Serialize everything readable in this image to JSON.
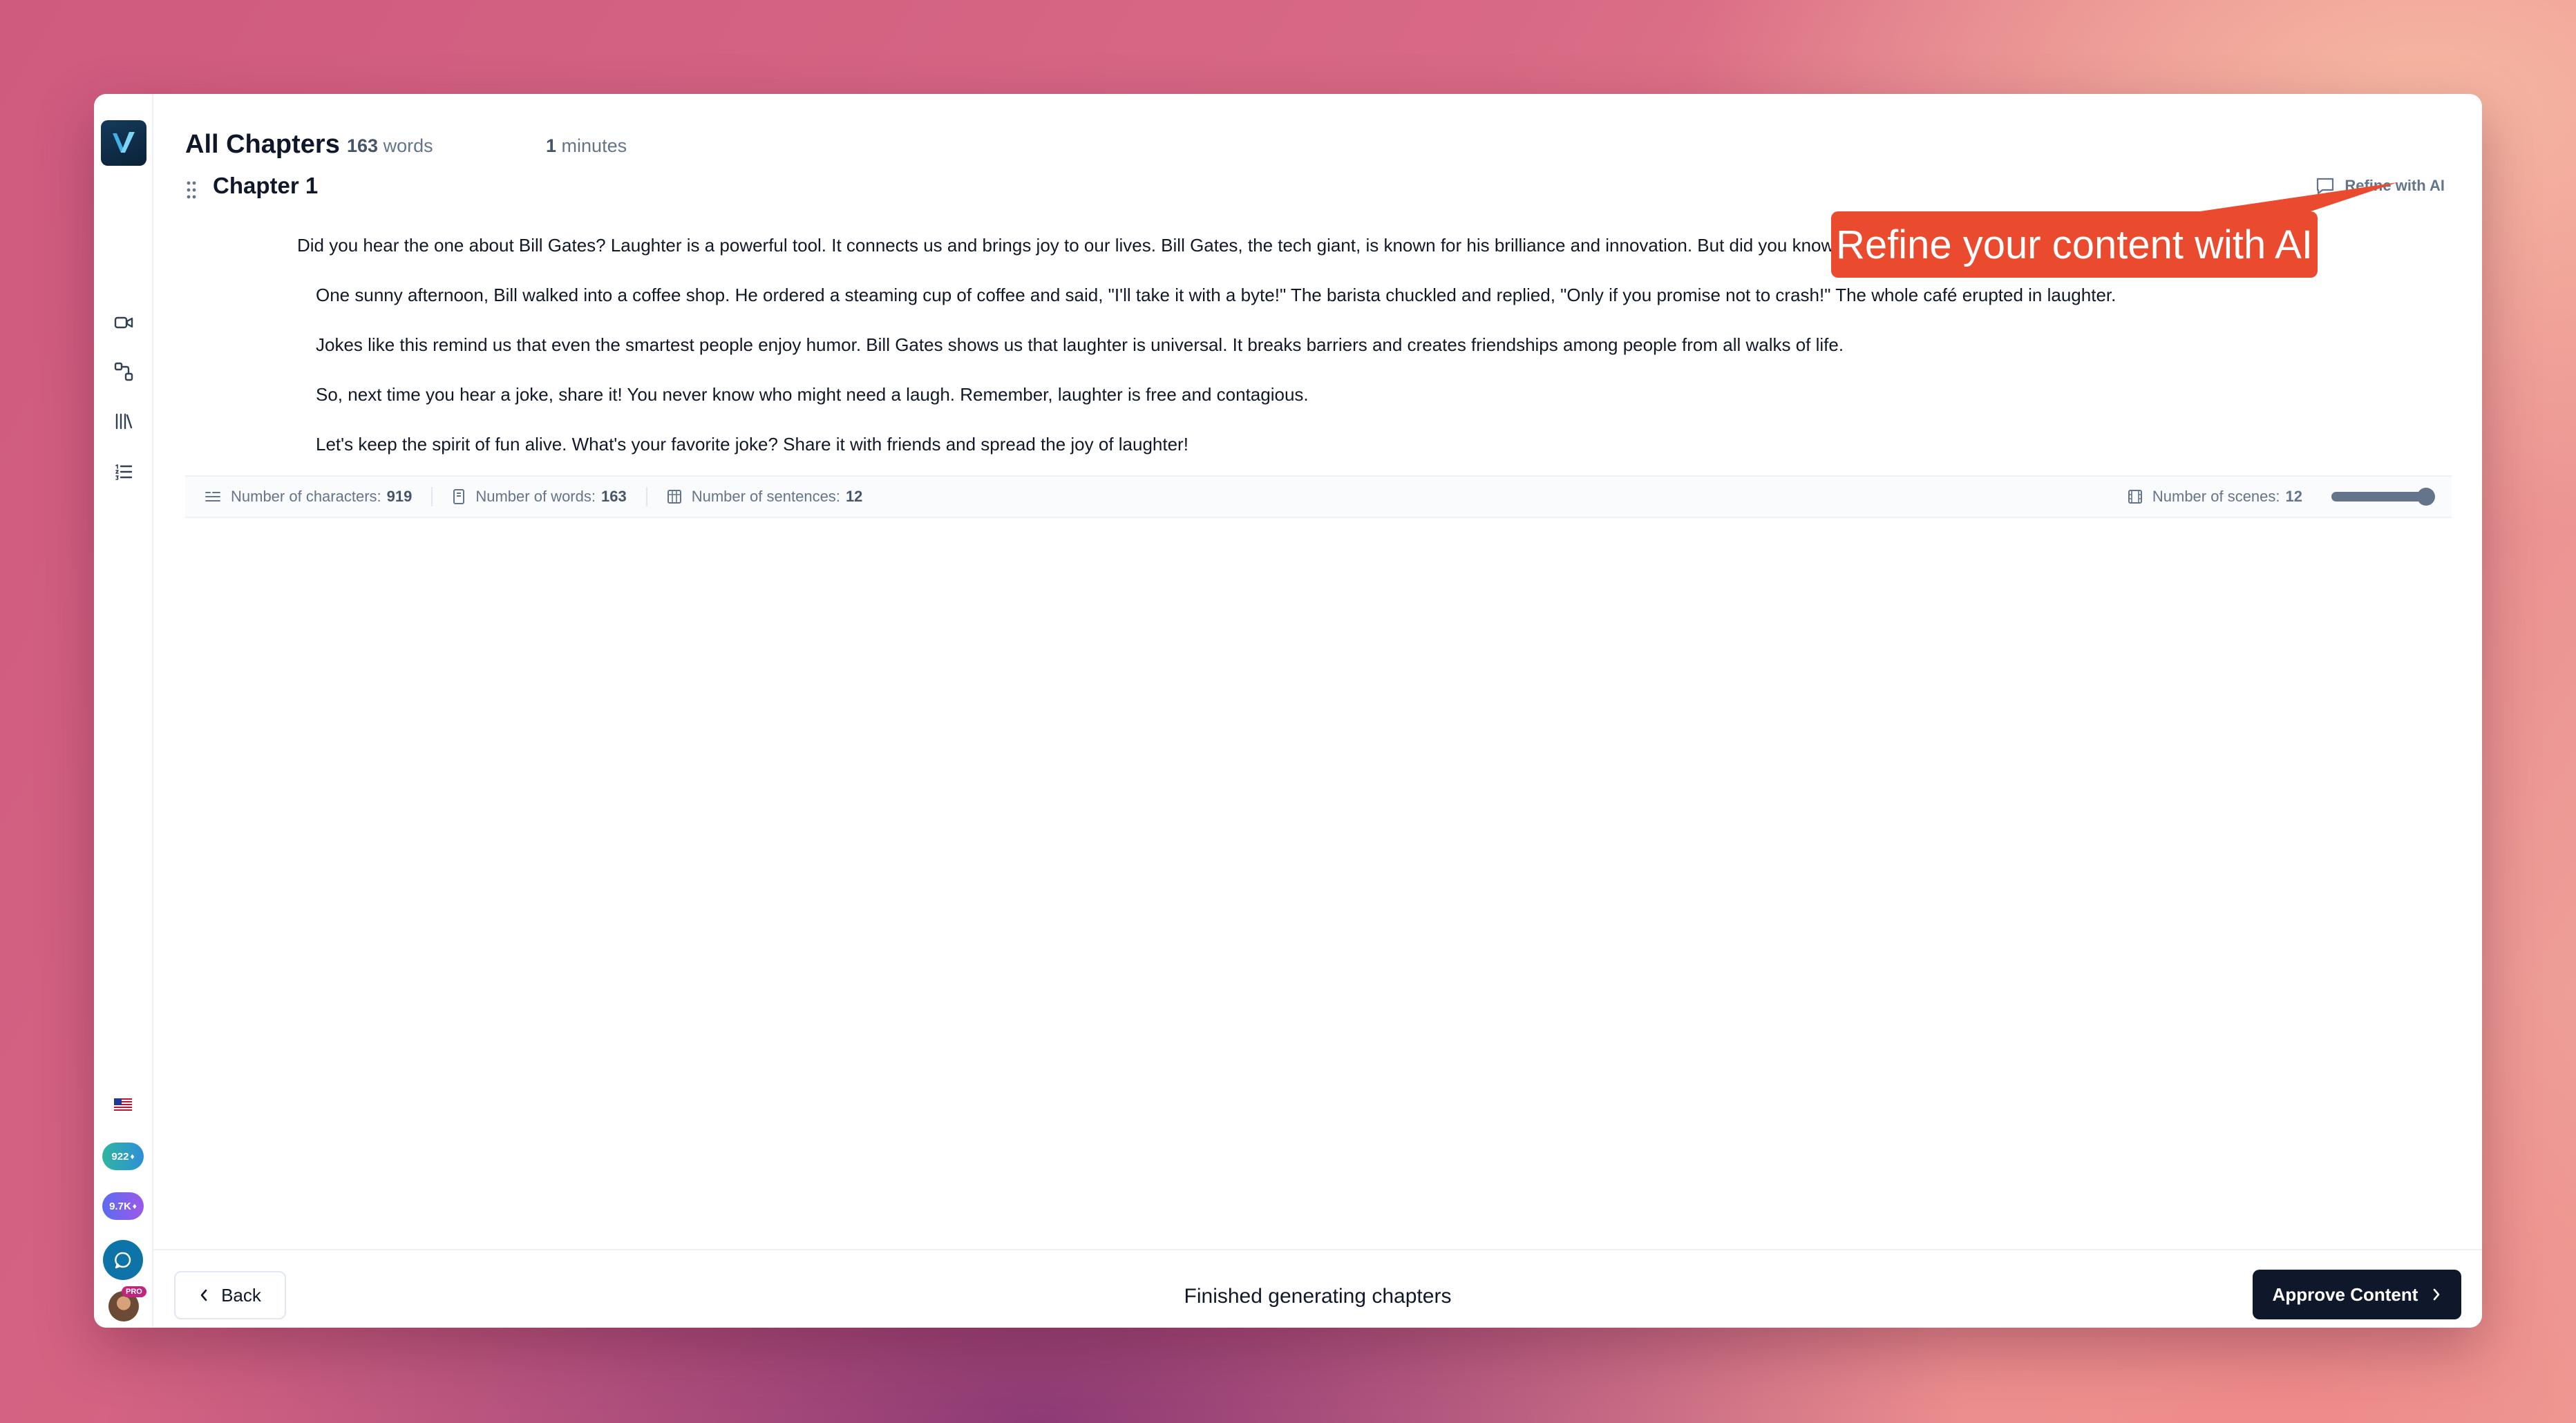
{
  "header": {
    "title": "All Chapters",
    "word_count": "163",
    "word_unit": "words",
    "minutes": "1",
    "minutes_unit": "minutes"
  },
  "chapter": {
    "title": "Chapter 1",
    "refine_label": "Refine with AI",
    "paragraphs": [
      "Did you hear the one about Bill Gates? Laughter is a powerful tool. It connects us and brings joy to our lives. Bill Gates, the tech giant, is known for his brilliance and innovation. But did you know he has a f",
      "One sunny afternoon, Bill walked into a coffee shop. He ordered a steaming cup of coffee and said, \"I'll take it with a byte!\" The barista chuckled and replied, \"Only if you promise not to crash!\" The whole café erupted in laughter.",
      "Jokes like this remind us that even the smartest people enjoy humor. Bill Gates shows us that laughter is universal. It breaks barriers and creates friendships among people from all walks of life.",
      "So, next time you hear a joke, share it! You never know who might need a laugh. Remember, laughter is free and contagious.",
      "Let's keep the spirit of fun alive. What's your favorite joke? Share it with friends and spread the joy of laughter!"
    ]
  },
  "stats": {
    "characters_label": "Number of characters:",
    "characters": "919",
    "words_label": "Number of words:",
    "words": "163",
    "sentences_label": "Number of sentences:",
    "sentences": "12",
    "scenes_label": "Number of scenes:",
    "scenes": "12",
    "scenes_slider_fraction": 1.0
  },
  "callout": {
    "text": "Refine your content with AI"
  },
  "sidebar": {
    "credits_a": "922",
    "credits_b": "9.7K",
    "badge": "PRO",
    "icons": [
      "video-icon",
      "workflow-icon",
      "library-icon",
      "list-icon"
    ]
  },
  "footer": {
    "back_label": "Back",
    "status": "Finished generating chapters",
    "approve_label": "Approve Content"
  },
  "colors": {
    "accent": "#ea4a2e",
    "primary_button": "#0f172a",
    "brand": "#0e74a8"
  }
}
